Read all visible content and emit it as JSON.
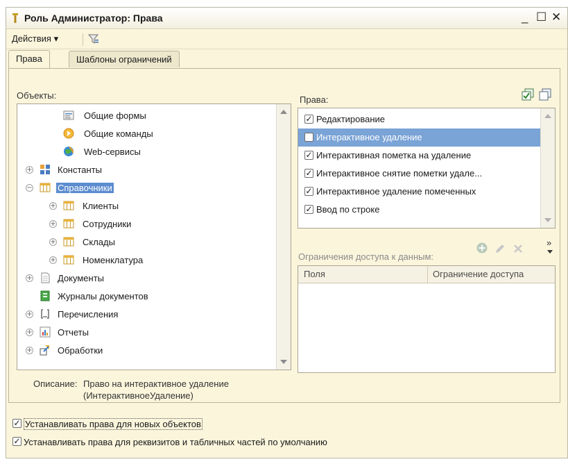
{
  "window": {
    "title": "Роль Администратор: Права",
    "minimize": "_",
    "maximize": "☐",
    "close": "✕"
  },
  "toolbar": {
    "actions_label": "Действия ▾",
    "filter_icon": "filter-icon"
  },
  "tabs": [
    {
      "label": "Права",
      "active": true
    },
    {
      "label": "Шаблоны ограничений",
      "active": false
    }
  ],
  "objects": {
    "label": "Объекты:",
    "items": [
      {
        "text": "Общие формы",
        "icon": "form-icon",
        "expander": "",
        "level": 2
      },
      {
        "text": "Общие команды",
        "icon": "command-icon",
        "expander": "",
        "level": 2
      },
      {
        "text": "Web-сервисы",
        "icon": "web-service-icon",
        "expander": "",
        "level": 2
      },
      {
        "text": "Константы",
        "icon": "constants-icon",
        "expander": "+",
        "level": 0
      },
      {
        "text": "Справочники",
        "icon": "catalog-icon",
        "expander": "−",
        "level": 0,
        "selected": true
      },
      {
        "text": "Клиенты",
        "icon": "catalog-icon",
        "expander": "+",
        "level": 1
      },
      {
        "text": "Сотрудники",
        "icon": "catalog-icon",
        "expander": "+",
        "level": 1
      },
      {
        "text": "Склады",
        "icon": "catalog-icon",
        "expander": "+",
        "level": 1
      },
      {
        "text": "Номенклатура",
        "icon": "catalog-icon",
        "expander": "+",
        "level": 1
      },
      {
        "text": "Документы",
        "icon": "document-icon",
        "expander": "+",
        "level": 0
      },
      {
        "text": "Журналы документов",
        "icon": "journal-icon",
        "expander": "",
        "level": 0
      },
      {
        "text": "Перечисления",
        "icon": "enum-icon",
        "expander": "+",
        "level": 0
      },
      {
        "text": "Отчеты",
        "icon": "report-icon",
        "expander": "+",
        "level": 0
      },
      {
        "text": "Обработки",
        "icon": "processing-icon",
        "expander": "+",
        "level": 0
      }
    ]
  },
  "rights": {
    "label": "Права:",
    "items": [
      {
        "text": "Редактирование",
        "checked": true
      },
      {
        "text": "Интерактивное удаление",
        "checked": false,
        "selected": true
      },
      {
        "text": "Интерактивная пометка на удаление",
        "checked": true
      },
      {
        "text": "Интерактивное снятие пометки удале...",
        "checked": true
      },
      {
        "text": "Интерактивное удаление помеченных",
        "checked": true
      },
      {
        "text": "Ввод по строке",
        "checked": true
      }
    ]
  },
  "restrictions": {
    "label": "Ограничения доступа к данным:",
    "columns": [
      "Поля",
      "Ограничение доступа"
    ],
    "more": "»"
  },
  "description": {
    "label": "Описание:",
    "line1": "Право на интерактивное удаление",
    "line2": "(ИнтерактивноеУдаление)"
  },
  "options": [
    {
      "text": "Устанавливать права для новых объектов",
      "checked": true
    },
    {
      "text": "Устанавливать права для реквизитов и табличных частей по умолчанию",
      "checked": true
    }
  ],
  "colors": {
    "window_bg": "#fbf5dc",
    "selection": "#7aa3d6",
    "tree_selection": "#5c8ccf"
  }
}
